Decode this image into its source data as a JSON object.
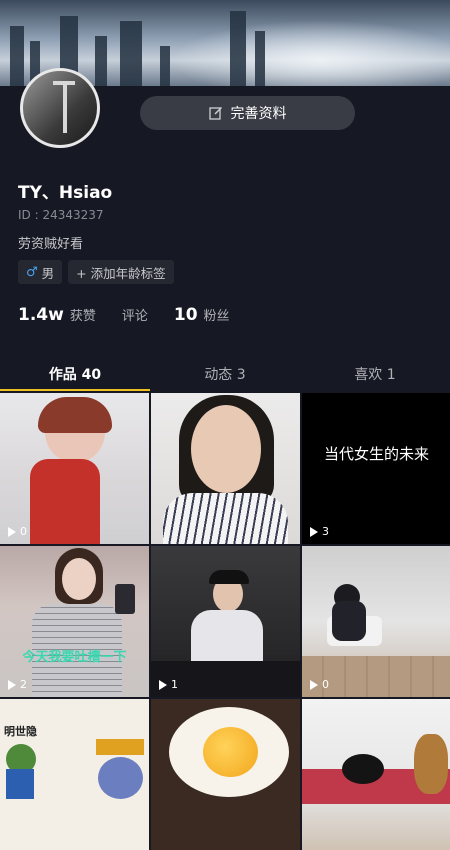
{
  "header": {
    "edit_button_label": "完善资料",
    "edit_icon": "edit-icon"
  },
  "profile": {
    "username": "TY、Hsiao",
    "id_text": "ID : 24343237",
    "bio": "劳资贼好看",
    "gender_icon": "male-icon",
    "gender_label": "男",
    "add_age_tag_label": "+ 添加年龄标签"
  },
  "stats": {
    "likes_value": "1.4w",
    "likes_label": "获赞",
    "comments_label": "评论",
    "fans_value": "10",
    "fans_label": "粉丝"
  },
  "tabs": [
    {
      "label": "作品 40"
    },
    {
      "label": "动态 3"
    },
    {
      "label": "喜欢 1"
    }
  ],
  "videos": [
    {
      "play_count": "0"
    },
    {
      "play_count": ""
    },
    {
      "play_count": "3",
      "overlay_text": "当代女生的未来"
    },
    {
      "play_count": "2",
      "overlay_text": "今天我要吐槽一下"
    },
    {
      "play_count": "1"
    },
    {
      "play_count": "0"
    },
    {
      "play_count": "",
      "overlay_text": "明世隐"
    },
    {
      "play_count": ""
    },
    {
      "play_count": ""
    }
  ],
  "colors": {
    "background": "#161823",
    "accent_tab_indicator": "#f0c020",
    "male_blue": "#4aa3f0"
  }
}
